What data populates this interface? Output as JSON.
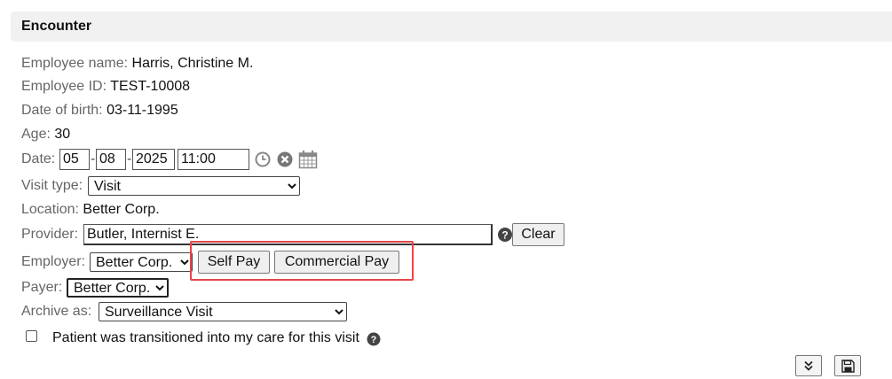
{
  "section_title": "Encounter",
  "fields": {
    "employee_name": {
      "label": "Employee name:",
      "value": "Harris, Christine M."
    },
    "employee_id": {
      "label": "Employee ID:",
      "value": "TEST-10008"
    },
    "dob": {
      "label": "Date of birth:",
      "value": "03-11-1995"
    },
    "age": {
      "label": "Age:",
      "value": "30"
    },
    "date": {
      "label": "Date:",
      "month": "05",
      "day": "08",
      "year": "2025",
      "time": "11:00",
      "sep": "-"
    },
    "visit_type": {
      "label": "Visit type:",
      "selected": "Visit"
    },
    "location": {
      "label": "Location:",
      "value": "Better Corp."
    },
    "provider": {
      "label": "Provider:",
      "value": "Butler, Internist E.",
      "clear_label": "Clear"
    },
    "employer": {
      "label": "Employer:",
      "selected": "Better Corp.",
      "self_pay_label": "Self Pay",
      "commercial_pay_label": "Commercial Pay"
    },
    "payer": {
      "label": "Payer:",
      "selected": "Better Corp."
    },
    "archive_as": {
      "label": "Archive as:",
      "selected": "Surveillance Visit"
    },
    "transitioned": {
      "label": "Patient was transitioned into my care for this visit",
      "checked": false
    }
  },
  "colors": {
    "highlight": "#e3474b",
    "header_bg": "#f1f1f1"
  },
  "icons": [
    "clock-icon",
    "clear-date-icon",
    "calendar-icon",
    "help-icon",
    "expand-down-icon",
    "save-icon"
  ]
}
